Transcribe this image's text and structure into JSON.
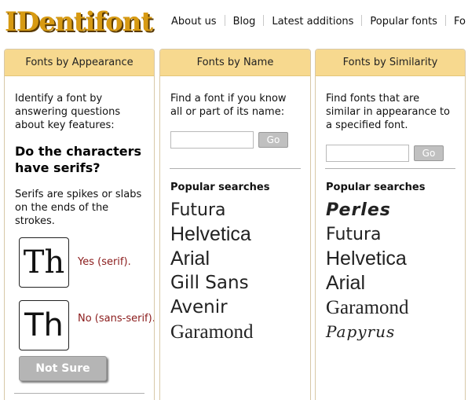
{
  "header": {
    "logo_text": "IDentifont",
    "nav": [
      "About us",
      "Blog",
      "Latest additions",
      "Popular fonts",
      "Fo"
    ]
  },
  "appearance": {
    "title": "Fonts by Appearance",
    "description": "Identify a font by answering questions about key features:",
    "question": "Do the characters have serifs?",
    "hint": "Serifs are spikes or slabs on the ends of the strokes.",
    "options": [
      {
        "glyph": "Th",
        "label": "Yes (serif)."
      },
      {
        "glyph": "Th",
        "label": "No (sans-serif)."
      }
    ],
    "not_sure": "Not Sure"
  },
  "by_name": {
    "title": "Fonts by Name",
    "description": "Find a font if you know all or part of its name:",
    "input_value": "",
    "go": "Go",
    "popular_title": "Popular searches",
    "popular": [
      "Futura",
      "Helvetica",
      "Arial",
      "Gill Sans",
      "Avenir",
      "Garamond"
    ]
  },
  "by_similarity": {
    "title": "Fonts by Similarity",
    "description": "Find fonts that are similar in appearance to a specified font.",
    "input_value": "",
    "go": "Go",
    "popular_title": "Popular searches",
    "popular": [
      "Perles",
      "Futura",
      "Helvetica",
      "Arial",
      "Garamond",
      "Papyrus"
    ]
  },
  "colors": {
    "header_bar": "#f7d98f",
    "logo": "#d79a12",
    "option_label": "#8a1a1a"
  }
}
